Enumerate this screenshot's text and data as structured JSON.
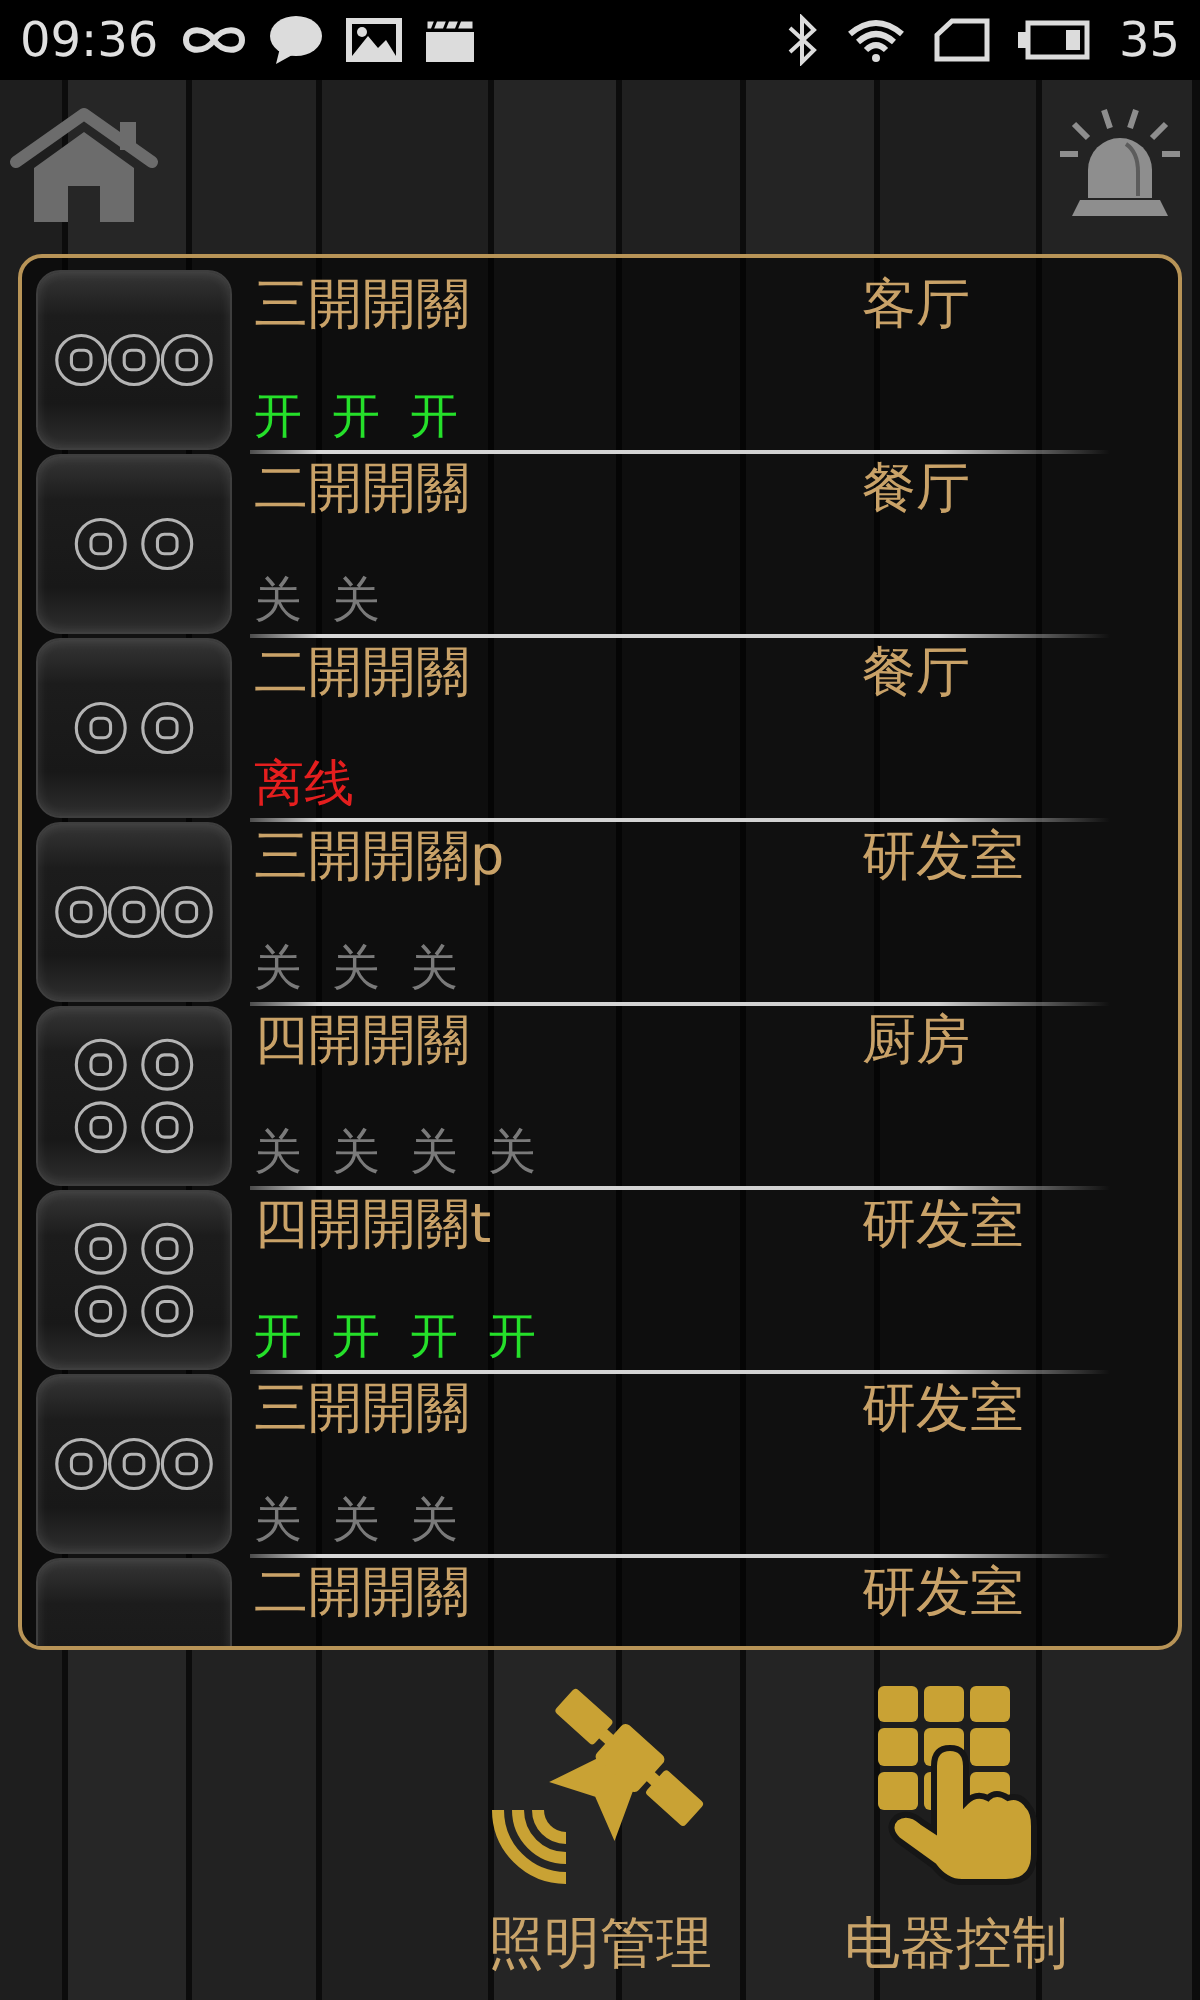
{
  "status_bar": {
    "time": "09:36",
    "battery_percent": "35"
  },
  "device_list": {
    "rows": [
      {
        "name": "三開開關",
        "room": "客厅",
        "kind": "triple",
        "switches": [
          {
            "label": "开",
            "on": true
          },
          {
            "label": "开",
            "on": true
          },
          {
            "label": "开",
            "on": true
          }
        ]
      },
      {
        "name": "二開開關",
        "room": "餐厅",
        "kind": "double",
        "switches": [
          {
            "label": "关",
            "on": false
          },
          {
            "label": "关",
            "on": false
          }
        ]
      },
      {
        "name": "二開開關",
        "room": "餐厅",
        "kind": "double",
        "status_label": "离线"
      },
      {
        "name": "三開開關p",
        "room": "研发室",
        "kind": "triple",
        "switches": [
          {
            "label": "关",
            "on": false
          },
          {
            "label": "关",
            "on": false
          },
          {
            "label": "关",
            "on": false
          }
        ]
      },
      {
        "name": "四開開關",
        "room": "厨房",
        "kind": "quad",
        "switches": [
          {
            "label": "关",
            "on": false
          },
          {
            "label": "关",
            "on": false
          },
          {
            "label": "关",
            "on": false
          },
          {
            "label": "关",
            "on": false
          }
        ]
      },
      {
        "name": "四開開關t",
        "room": "研发室",
        "kind": "quad",
        "switches": [
          {
            "label": "开",
            "on": true
          },
          {
            "label": "开",
            "on": true
          },
          {
            "label": "开",
            "on": true
          },
          {
            "label": "开",
            "on": true
          }
        ]
      },
      {
        "name": "三開開關",
        "room": "研发室",
        "kind": "triple",
        "switches": [
          {
            "label": "关",
            "on": false
          },
          {
            "label": "关",
            "on": false
          },
          {
            "label": "关",
            "on": false
          }
        ]
      }
    ],
    "partial_row": {
      "name": "二開開關",
      "room": "研发室"
    }
  },
  "bottom_nav": [
    {
      "label": "照明管理",
      "kind": "lighting"
    },
    {
      "label": "电器控制",
      "kind": "appliance"
    }
  ]
}
